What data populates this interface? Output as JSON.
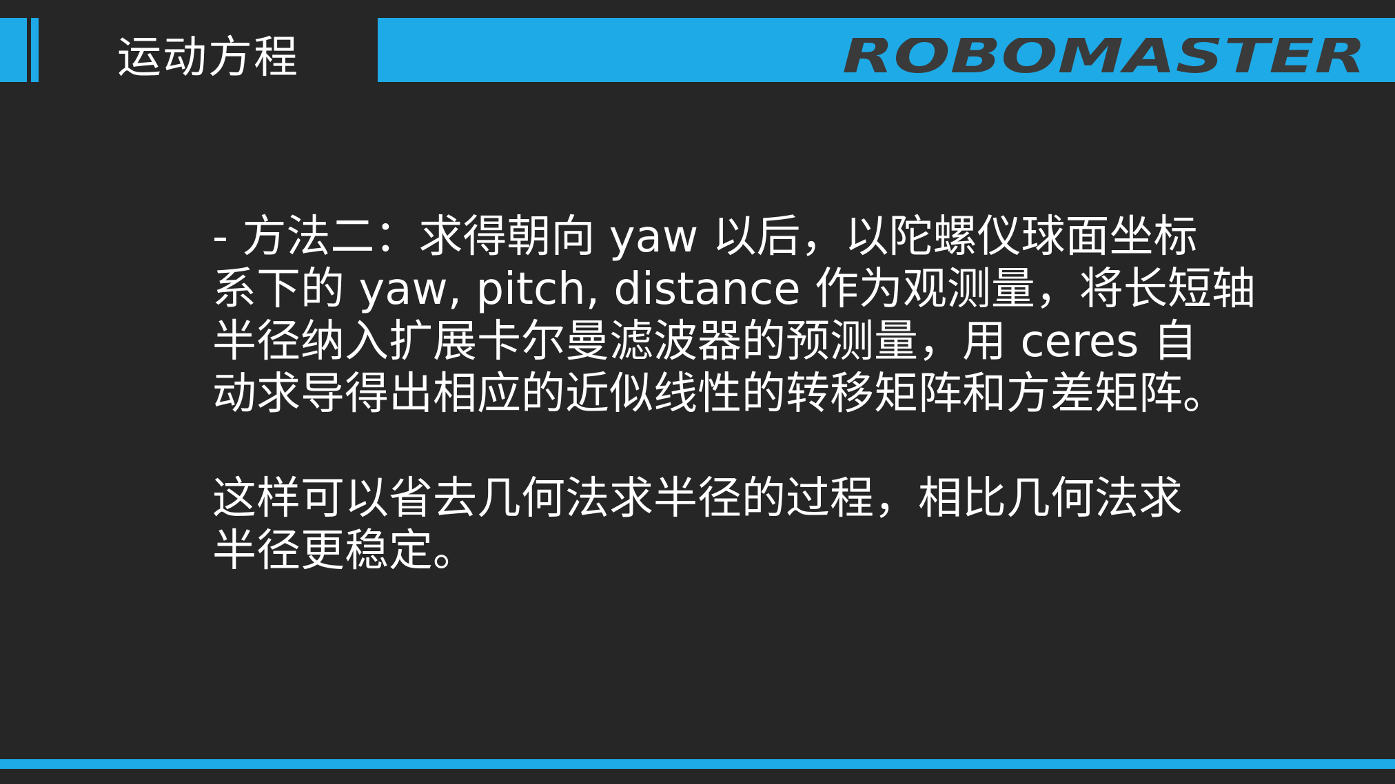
{
  "slide": {
    "title": "运动方程",
    "brand": "ROBOMASTER",
    "paragraphs": [
      {
        "lines": [
          "- 方法二：求得朝向 yaw 以后，以陀螺仪球面坐标",
          "系下的 yaw, pitch, distance 作为观测量，将长短轴",
          "半径纳入扩展卡尔曼滤波器的预测量，用 ceres 自",
          "动求导得出相应的近似线性的转移矩阵和方差矩阵。"
        ]
      },
      {
        "lines": [
          "这样可以省去几何法求半径的过程，相比几何法求",
          "半径更稳定。"
        ]
      }
    ]
  },
  "colors": {
    "background": "#262626",
    "accent": "#1eaae6",
    "logo": "#3a3a3a",
    "text": "#ffffff"
  }
}
